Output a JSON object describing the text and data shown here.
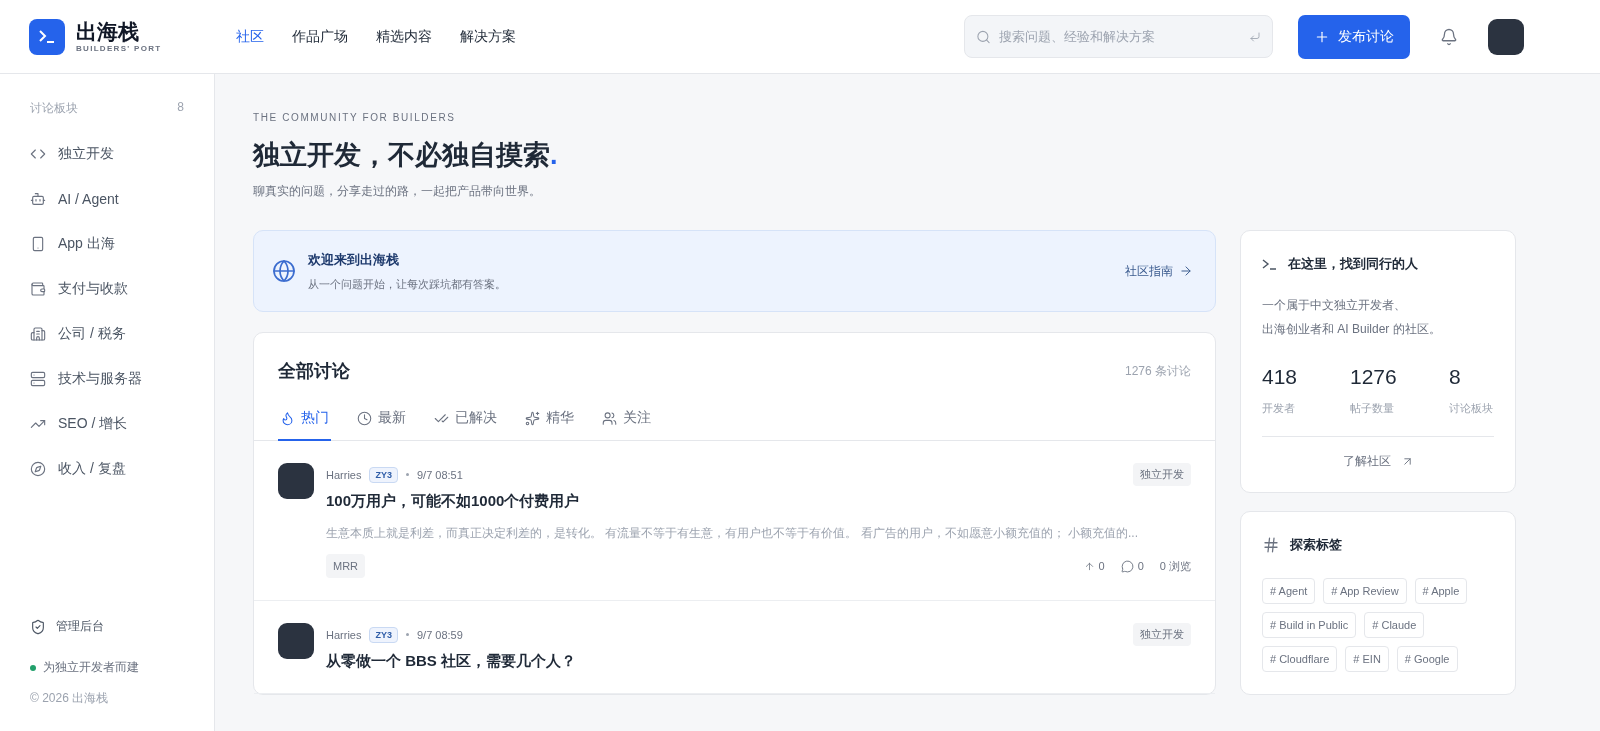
{
  "brand": {
    "name": "出海栈",
    "tagline": "BUILDERS' PORT"
  },
  "nav": [
    {
      "label": "社区",
      "selected": true
    },
    {
      "label": "作品广场",
      "selected": false
    },
    {
      "label": "精选内容",
      "selected": false
    },
    {
      "label": "解决方案",
      "selected": false
    }
  ],
  "search": {
    "placeholder": "搜索问题、经验和解决方案"
  },
  "publish_button": "发布讨论",
  "sidebar": {
    "heading": "讨论板块",
    "count": "8",
    "items": [
      {
        "kind": "code",
        "label": "独立开发"
      },
      {
        "kind": "bot",
        "label": "AI / Agent"
      },
      {
        "kind": "phone",
        "label": "App 出海"
      },
      {
        "kind": "wallet",
        "label": "支付与收款"
      },
      {
        "kind": "building",
        "label": "公司 / 税务"
      },
      {
        "kind": "server",
        "label": "技术与服务器"
      },
      {
        "kind": "trend",
        "label": "SEO / 增长"
      },
      {
        "kind": "compass",
        "label": "收入 / 复盘"
      }
    ],
    "admin_link": "管理后台",
    "footer_note": "为独立开发者而建",
    "copyright": "© 2026 出海栈"
  },
  "hero": {
    "eyebrow": "THE COMMUNITY FOR BUILDERS",
    "title": "独立开发，不必独自摸索",
    "title_mark": ".",
    "subtitle": "聊真实的问题，分享走过的路，一起把产品带向世界。"
  },
  "notice": {
    "title": "欢迎来到出海栈",
    "text": "从一个问题开始，让每次踩坑都有答案。",
    "link": "社区指南"
  },
  "discussions": {
    "title": "全部讨论",
    "count": "1276 条讨论",
    "tabs": [
      {
        "kind": "flame",
        "label": "热门",
        "selected": true
      },
      {
        "kind": "clock",
        "label": "最新",
        "selected": false
      },
      {
        "kind": "check",
        "label": "已解决",
        "selected": false
      },
      {
        "kind": "sparkles",
        "label": "精华",
        "selected": false
      },
      {
        "kind": "users",
        "label": "关注",
        "selected": false
      }
    ],
    "posts": [
      {
        "author": "Harries",
        "badge": "ZY3",
        "time": "9/7 08:51",
        "category": "独立开发",
        "title": "100万用户，可能不如1000个付费用户",
        "excerpt": "生意本质上就是利差，而真正决定利差的，是转化。 有流量不等于有生意，有用户也不等于有价值。 看广告的用户，不如愿意小额充值的； 小额充值的...",
        "tags": [
          "MRR"
        ],
        "upvotes": "0",
        "comments": "0",
        "views": "0 浏览"
      },
      {
        "author": "Harries",
        "badge": "ZY3",
        "time": "9/7 08:59",
        "category": "独立开发",
        "title": "从零做一个 BBS 社区，需要几个人？"
      }
    ]
  },
  "about": {
    "title": "在这里，找到同行的人",
    "text_lines": [
      "一个属于中文独立开发者、",
      "出海创业者和 AI Builder 的社区。"
    ],
    "stats": [
      {
        "value": "418",
        "label": "开发者"
      },
      {
        "value": "1276",
        "label": "帖子数量"
      },
      {
        "value": "8",
        "label": "讨论板块"
      }
    ],
    "link": "了解社区"
  },
  "tags_card": {
    "title": "探索标签",
    "tags": [
      "# Agent",
      "# App Review",
      "# Apple",
      "# Build in Public",
      "# Claude",
      "# Cloudflare",
      "# EIN",
      "# Google"
    ]
  }
}
